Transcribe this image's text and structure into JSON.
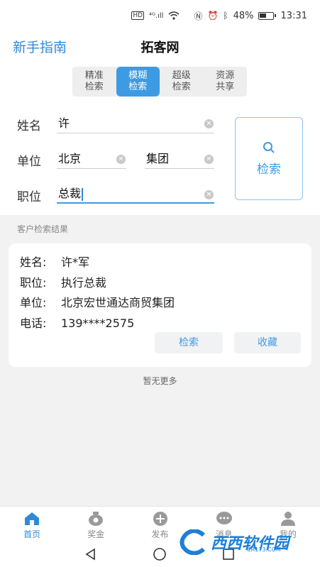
{
  "status_bar": {
    "network": "HD",
    "signal": "⁴ᴳ.ıll",
    "battery_text": "48%",
    "time": "13:31"
  },
  "header": {
    "guide_label": "新手指南",
    "title": "拓客网"
  },
  "mode_tabs": [
    {
      "line1": "精准",
      "line2": "检索",
      "active": false
    },
    {
      "line1": "模糊",
      "line2": "检索",
      "active": true
    },
    {
      "line1": "超级",
      "line2": "检索",
      "active": false
    },
    {
      "line1": "资源",
      "line2": "共享",
      "active": false
    }
  ],
  "form": {
    "name_label": "姓名",
    "name_value": "许",
    "unit_label": "单位",
    "unit_value_1": "北京",
    "unit_value_2": "集团",
    "position_label": "职位",
    "position_value": "总裁",
    "search_button_label": "检索"
  },
  "results": {
    "caption": "客户检索结果",
    "card": {
      "name_key": "姓名:",
      "name_value": "许*军",
      "position_key": "职位:",
      "position_value": "执行总裁",
      "unit_key": "单位:",
      "unit_value": "北京宏世通达商贸集团",
      "phone_key": "电话:",
      "phone_value": "139****2575",
      "search_button": "检索",
      "favorite_button": "收藏"
    },
    "no_more": "暂无更多"
  },
  "tab_bar": [
    {
      "label": "首页",
      "icon": "home-icon",
      "active": true
    },
    {
      "label": "奖金",
      "icon": "money-bag-icon",
      "active": false
    },
    {
      "label": "发布",
      "icon": "plus-circle-icon",
      "active": false
    },
    {
      "label": "消息",
      "icon": "chat-icon",
      "active": false
    },
    {
      "label": "我的",
      "icon": "user-icon",
      "active": false
    }
  ],
  "watermark": {
    "text": "西西软件园",
    "sub": "CR173.COM"
  },
  "colors": {
    "accent": "#3d9be3",
    "link": "#2e8ad8"
  }
}
